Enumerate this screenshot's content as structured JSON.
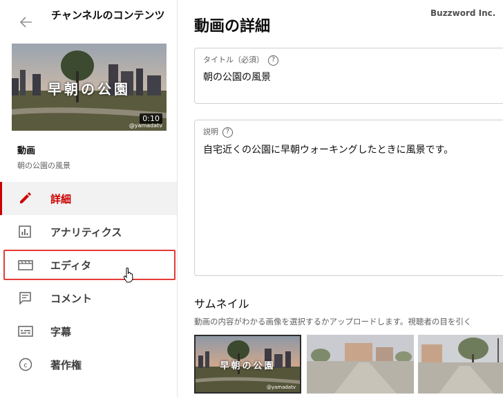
{
  "sidebar": {
    "channel_title": "チャンネルのコンテンツ",
    "thumbnail": {
      "overlay_text": "早朝の公園",
      "duration": "0:10",
      "handle": "@yamadatv"
    },
    "video_label": "動画",
    "video_name": "朝の公園の風景",
    "nav": [
      {
        "label": "詳細",
        "icon": "pencil-icon",
        "active": true
      },
      {
        "label": "アナリティクス",
        "icon": "analytics-icon",
        "active": false
      },
      {
        "label": "エディタ",
        "icon": "editor-icon",
        "active": false
      },
      {
        "label": "コメント",
        "icon": "comment-icon",
        "active": false
      },
      {
        "label": "字幕",
        "icon": "subtitles-icon",
        "active": false
      },
      {
        "label": "著作権",
        "icon": "copyright-icon",
        "active": false
      }
    ]
  },
  "main": {
    "title": "動画の詳細",
    "brand": "Buzzword Inc.",
    "title_field": {
      "label": "タイトル（必須）",
      "value": "朝の公園の風景"
    },
    "description_field": {
      "label": "説明",
      "value": "自宅近くの公園に早朝ウォーキングしたときに風景です。"
    },
    "thumbnails": {
      "heading": "サムネイル",
      "description": "動画の内容がわかる画像を選択するかアップロードします。視聴者の目を引く",
      "selected_overlay": "早朝の公園",
      "selected_handle": "@yamadatv"
    }
  },
  "colors": {
    "accent": "#cc0000",
    "highlight_border": "#e53935"
  }
}
